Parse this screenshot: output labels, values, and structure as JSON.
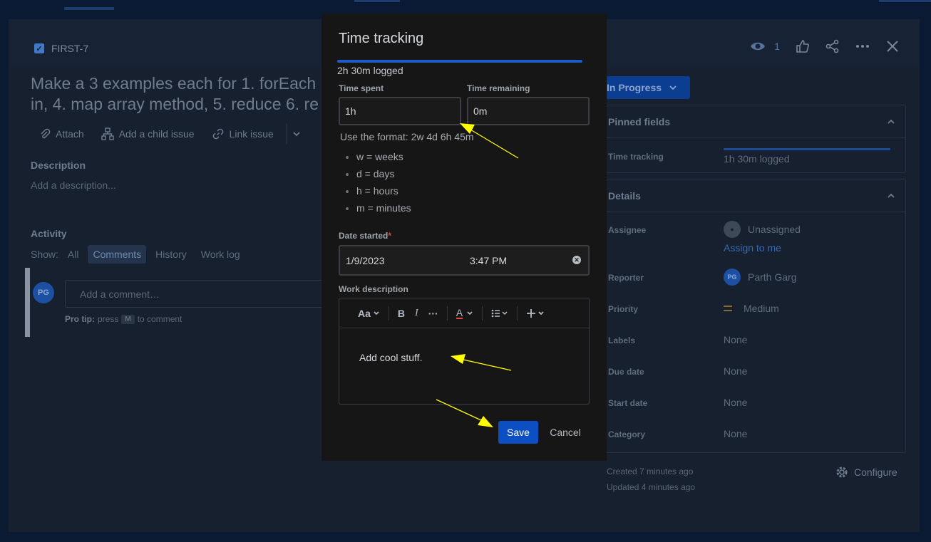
{
  "issue": {
    "key": "FIRST-7",
    "title_line1": "Make a 3 examples each for 1. forEach",
    "title_line2": "in, 4. map array method, 5. reduce 6. re",
    "watch_count": "1",
    "status": "In Progress"
  },
  "toolbar": {
    "attach": "Attach",
    "add_child": "Add a child issue",
    "link_issue": "Link issue"
  },
  "description": {
    "label": "Description",
    "placeholder": "Add a description..."
  },
  "activity": {
    "label": "Activity",
    "show_label": "Show:",
    "filters": [
      "All",
      "Comments",
      "History",
      "Work log"
    ],
    "avatar_initials": "PG",
    "comment_placeholder": "Add a comment…",
    "pro_tip_label": "Pro tip:",
    "pro_tip_press": "press",
    "pro_tip_key": "M",
    "pro_tip_rest": "to comment"
  },
  "pinned": {
    "title": "Pinned fields",
    "time_tracking_label": "Time tracking",
    "time_tracking_value": "1h 30m logged"
  },
  "details": {
    "title": "Details",
    "assignee_label": "Assignee",
    "assignee_value": "Unassigned",
    "assign_to_me": "Assign to me",
    "reporter_label": "Reporter",
    "reporter_initials": "PG",
    "reporter_value": "Parth Garg",
    "priority_label": "Priority",
    "priority_value": "Medium",
    "labels_label": "Labels",
    "labels_value": "None",
    "due_date_label": "Due date",
    "due_date_value": "None",
    "start_date_label": "Start date",
    "start_date_value": "None",
    "category_label": "Category",
    "category_value": "None"
  },
  "meta": {
    "created": "Created 7 minutes ago",
    "updated": "Updated 4 minutes ago",
    "configure": "Configure"
  },
  "dialog": {
    "title": "Time tracking",
    "logged": "2h 30m logged",
    "time_spent_label": "Time spent",
    "time_spent_value": "1h",
    "time_remaining_label": "Time remaining",
    "time_remaining_value": "0m",
    "format_hint": "Use the format: 2w 4d 6h 45m",
    "units": [
      "w = weeks",
      "d = days",
      "h = hours",
      "m = minutes"
    ],
    "date_started_label": "Date started",
    "required_mark": "*",
    "date_value": "1/9/2023",
    "time_value": "3:47 PM",
    "work_description_label": "Work description",
    "text_style": "Aa",
    "bold": "B",
    "italic": "I",
    "more": "···",
    "text_color": "A",
    "work_description_value": "Add cool stuff.",
    "save": "Save",
    "cancel": "Cancel"
  },
  "colors": {
    "accent": "#0c4fc3",
    "annotation": "#ffff00",
    "status_bg": "#0b3d90"
  }
}
